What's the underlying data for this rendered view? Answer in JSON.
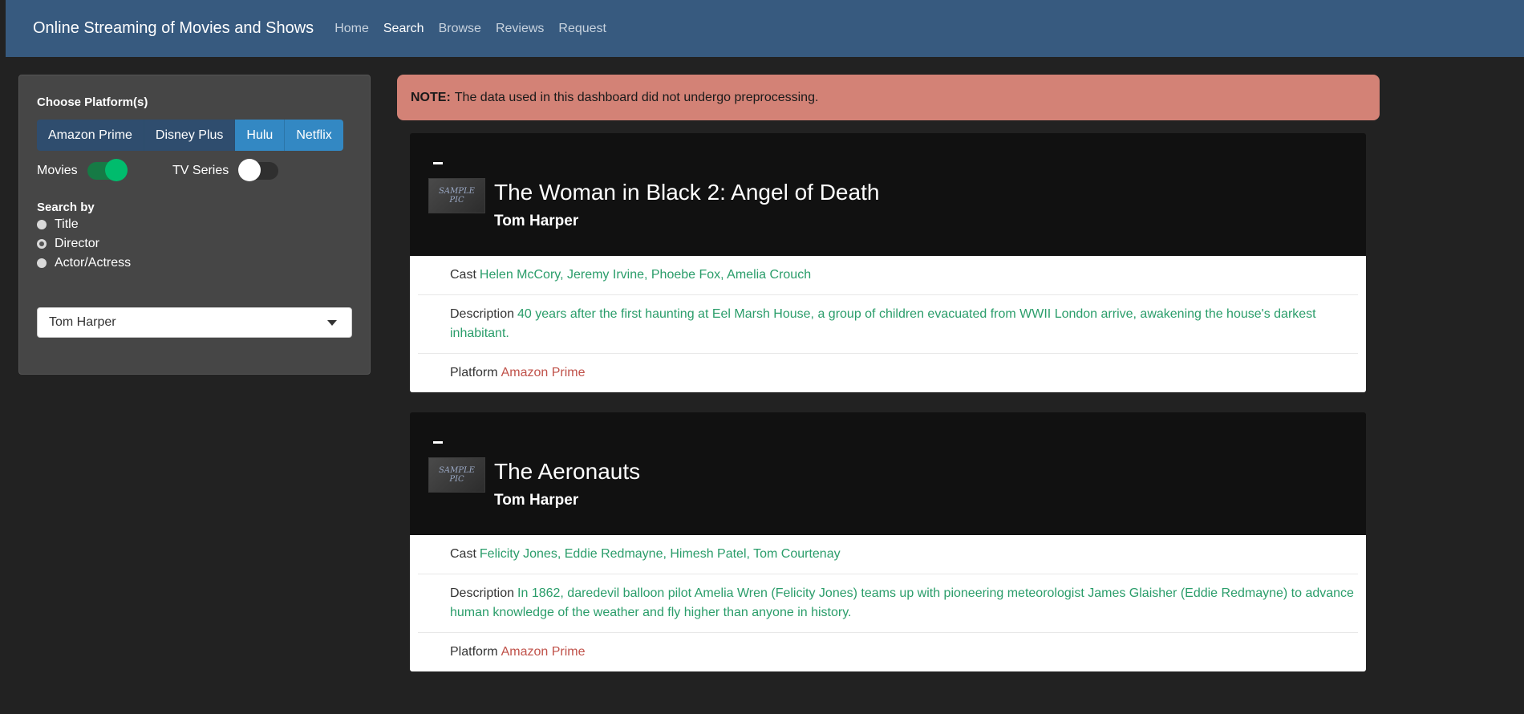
{
  "navbar": {
    "brand": "Online Streaming of Movies and Shows",
    "links": [
      "Home",
      "Search",
      "Browse",
      "Reviews",
      "Request"
    ],
    "active": "Search"
  },
  "sidebar": {
    "platform_label": "Choose Platform(s)",
    "platforms": [
      {
        "label": "Amazon Prime",
        "selected": false
      },
      {
        "label": "Disney Plus",
        "selected": false
      },
      {
        "label": "Hulu",
        "selected": true
      },
      {
        "label": "Netflix",
        "selected": true
      }
    ],
    "movies_label": "Movies",
    "movies_on": true,
    "tv_label": "TV Series",
    "tv_on": false,
    "search_by_label": "Search by",
    "search_options": [
      "Title",
      "Director",
      "Actor/Actress"
    ],
    "search_selected": "Director",
    "select_value": "Tom Harper"
  },
  "alert": {
    "bold": "NOTE:",
    "text": "The data used in this dashboard did not undergo preprocessing."
  },
  "thumb": {
    "line1": "SAMPLE",
    "line2": "PIC"
  },
  "labels": {
    "cast": "Cast",
    "description": "Description",
    "platform": "Platform"
  },
  "results": [
    {
      "title": "The Woman in Black 2: Angel of Death",
      "director": "Tom Harper",
      "cast": "Helen McCory, Jeremy Irvine, Phoebe Fox, Amelia Crouch",
      "description": "40 years after the first haunting at Eel Marsh House, a group of children evacuated from WWII London arrive, awakening the house's darkest inhabitant.",
      "platform": "Amazon Prime"
    },
    {
      "title": "The Aeronauts",
      "director": "Tom Harper",
      "cast": "Felicity Jones, Eddie Redmayne, Himesh Patel, Tom Courtenay",
      "description": "In 1862, daredevil balloon pilot Amelia Wren (Felicity Jones) teams up with pioneering meteorologist James Glaisher (Eddie Redmayne) to advance human knowledge of the weather and fly higher than anyone in history.",
      "platform": "Amazon Prime"
    }
  ],
  "colors": {
    "navbar": "#375a7f",
    "background": "#222222",
    "alert": "#d38276",
    "accent_green": "#2a9d6a",
    "accent_red": "#c0524a",
    "toggle_on": "#00bc6d"
  }
}
